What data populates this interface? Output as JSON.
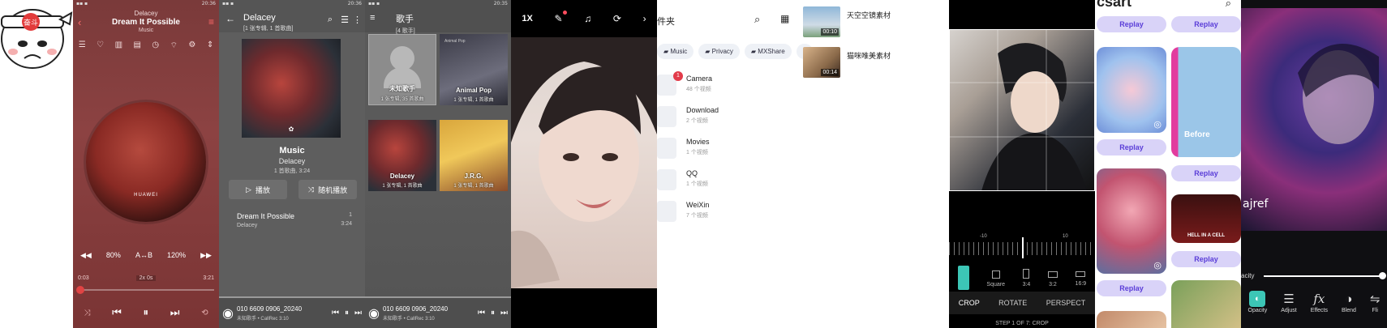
{
  "player": {
    "status_right": "20:36",
    "artist": "Delacey",
    "song": "Dream It Possible",
    "album": "Music",
    "disc_logo": "HUAWEI",
    "speed": "80%",
    "ab": "A↔B",
    "pitch": "120%",
    "time_start": "0:03",
    "time_mid": "2x 0s",
    "time_end": "3:21"
  },
  "album": {
    "status_right": "20:36",
    "title": "Delacey",
    "subtitle": "[1 张专辑, 1 首歌曲]",
    "album_title": "Music",
    "album_artist": "Delacey",
    "album_meta": "1 首歌曲, 3:24",
    "play_label": "播放",
    "shuffle_label": "随机播放",
    "track_title": "Dream It Possible",
    "track_artist": "Delacey",
    "track_num": "1",
    "track_len": "3:24",
    "mini_title": "010 6609 0906_20240",
    "mini_sub": "未知歌手 • CallRec",
    "mini_time": "3:10"
  },
  "artists": {
    "status_right": "20:35",
    "title": "歌手",
    "subtitle": "[4 歌手]",
    "tiles": [
      {
        "name": "未知歌手",
        "sub": "1 张专辑, 35 首歌曲"
      },
      {
        "name": "Animal Pop",
        "sub": "1 张专辑, 1 首歌曲"
      },
      {
        "name": "Delacey",
        "sub": "1 张专辑, 1 首歌曲"
      },
      {
        "name": "J.R.G.",
        "sub": "1 张专辑, 1 首歌曲"
      }
    ],
    "mini_title": "010 6609 0906_20240",
    "mini_sub": "未知歌手 • CallRec",
    "mini_time": "3:10"
  },
  "face": {
    "speed_label": "1X"
  },
  "files": {
    "title": "件夹",
    "tabs": [
      "Music",
      "Privacy",
      "MXShare"
    ],
    "folders": [
      {
        "name": "Camera",
        "count": "48 个视频",
        "badge": "1"
      },
      {
        "name": "Download",
        "count": "2 个视频"
      },
      {
        "name": "Movies",
        "count": "1 个视频"
      },
      {
        "name": "QQ",
        "count": "1 个视频"
      },
      {
        "name": "WeiXin",
        "count": "7 个视频"
      }
    ],
    "videos": [
      {
        "name": "天空空镜素材",
        "duration": "00:10"
      },
      {
        "name": "猫咪唯美素材",
        "duration": "00:14"
      }
    ]
  },
  "crop": {
    "ruler_left": "-10",
    "ruler_right": "10",
    "ratios": [
      "Square",
      "3:4",
      "3:2",
      "16:9"
    ],
    "modes": [
      "CROP",
      "ROTATE",
      "PERSPECT"
    ],
    "step": "STEP 1 OF 7: CROP"
  },
  "gallery": {
    "brand": "csart",
    "replay_label": "Replay",
    "before_label": "Before",
    "poster_label": "HELL IN A CELL"
  },
  "editor": {
    "slider_label": "acity",
    "tools": [
      "Opacity",
      "Adjust",
      "Effects",
      "Blend",
      "Fli"
    ]
  }
}
